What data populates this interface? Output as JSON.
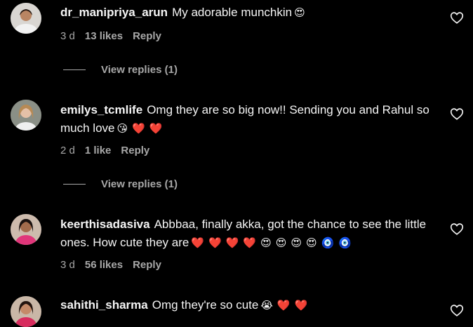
{
  "comments": [
    {
      "username": "dr_manipriya_arun",
      "text": "My adorable munchkin",
      "emojis": [
        "😍"
      ],
      "time": "3 d",
      "likes": "13 likes",
      "reply": "Reply",
      "view_replies": "View replies (1)"
    },
    {
      "username": "emilys_tcmlife",
      "text": "Omg they are so big now!! Sending you and Rahul so much love",
      "emojis": [
        "😘",
        "❤️",
        "❤️"
      ],
      "time": "2 d",
      "likes": "1 like",
      "reply": "Reply",
      "view_replies": "View replies (1)"
    },
    {
      "username": "keerthisadasiva",
      "text": "Abbbaa, finally akka, got the chance to see the little ones. How cute they are",
      "emojis": [
        "❤️",
        "❤️",
        "❤️",
        "❤️",
        "😍",
        "😍",
        "😍",
        "😍",
        "🧿",
        "🧿"
      ],
      "time": "3 d",
      "likes": "56 likes",
      "reply": "Reply"
    },
    {
      "username": "sahithi_sharma",
      "text": "Omg they're so cute",
      "emojis": [
        "😭",
        "❤️",
        "❤️"
      ]
    }
  ],
  "icons": {
    "like": "heart-outline-icon"
  },
  "colors": {
    "background": "#000000",
    "primary_text": "#f5f5f5",
    "secondary_text": "#a8a8a8",
    "heart_red": "#e0245e"
  }
}
